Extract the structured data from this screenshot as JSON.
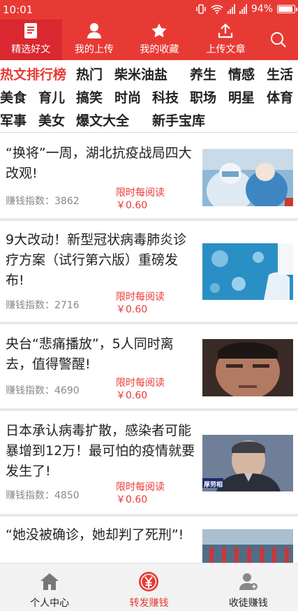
{
  "status_bar": {
    "time": "10:01",
    "battery": "94%"
  },
  "top_nav": {
    "tabs": [
      {
        "label": "精选好文",
        "icon": "document-icon",
        "active": true
      },
      {
        "label": "我的上传",
        "icon": "person-icon",
        "active": false
      },
      {
        "label": "我的收藏",
        "icon": "star-icon",
        "active": false
      },
      {
        "label": "上传文章",
        "icon": "upload-icon",
        "active": false
      }
    ],
    "search_icon": "search-icon",
    "colors": {
      "bar": "#e83a35",
      "active_tab": "#d9282f"
    }
  },
  "categories": [
    {
      "label": "热文排行榜",
      "active": true
    },
    {
      "label": "热门"
    },
    {
      "label": "柴米油盐"
    },
    {
      "label": "养生"
    },
    {
      "label": "情感"
    },
    {
      "label": "生活"
    },
    {
      "label": "美食"
    },
    {
      "label": "育儿"
    },
    {
      "label": "搞笑"
    },
    {
      "label": "时尚"
    },
    {
      "label": "科技"
    },
    {
      "label": "职场"
    },
    {
      "label": "明星"
    },
    {
      "label": "体育"
    },
    {
      "label": "军事"
    },
    {
      "label": "美女"
    },
    {
      "label": "爆文大全"
    },
    {
      "label": "新手宝库"
    }
  ],
  "articles": [
    {
      "title": "“换将”一周，湖北抗疫战局四大改观!",
      "index_label": "赚钱指数：3862",
      "reward_line1": "限时每阅读",
      "reward_line2": "￥0.60",
      "thumb_caption": ""
    },
    {
      "title": "9大改动！新型冠状病毒肺炎诊疗方案（试行第六版）重磅发布!",
      "index_label": "赚钱指数：2716",
      "reward_line1": "限时每阅读",
      "reward_line2": "￥0.60",
      "thumb_caption": ""
    },
    {
      "title": "央台“悲痛播放”，5人同时离去，值得警醒!",
      "index_label": "赚钱指数：4690",
      "reward_line1": "限时每阅读",
      "reward_line2": "￥0.60",
      "thumb_caption": ""
    },
    {
      "title": "日本承认病毒扩散，感染者可能暴增到12万！最可怕的疫情就要发生了!",
      "index_label": "赚钱指数：4850",
      "reward_line1": "限时每阅读",
      "reward_line2": "￥0.60",
      "thumb_caption": "厚劳相"
    },
    {
      "title": "“她没被确诊，她却判了死刑”!",
      "index_label": "",
      "reward_line1": "",
      "reward_line2": "",
      "thumb_caption": ""
    }
  ],
  "bottom_nav": {
    "items": [
      {
        "label": "个人中心",
        "icon": "home-icon",
        "active": false
      },
      {
        "label": "转发赚钱",
        "icon": "yuan-coin-icon",
        "active": true
      },
      {
        "label": "收徒赚钱",
        "icon": "add-user-icon",
        "active": false
      }
    ]
  },
  "colors": {
    "accent": "#e83a35",
    "muted_text": "#888888",
    "divider": "#e9e9e9"
  }
}
